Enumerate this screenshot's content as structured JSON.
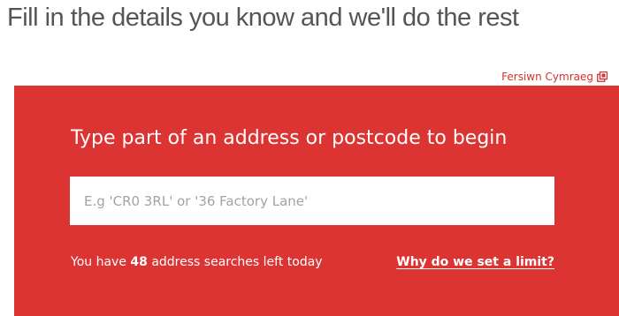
{
  "header": {
    "headline": "Fill in the details you know and we'll do the rest",
    "language_link": "Fersiwn Cymraeg",
    "language_icon": "external-link-icon"
  },
  "search_panel": {
    "prompt": "Type part of an address or postcode to begin",
    "search_placeholder": "E.g 'CR0 3RL' or '36 Factory Lane'",
    "search_value": "",
    "quota_prefix": "You have",
    "quota_count": "48",
    "quota_suffix": "address searches left today",
    "limit_link": "Why do we set a limit?"
  },
  "colors": {
    "accent": "#dc3333",
    "headline": "#555555",
    "placeholder": "#a3a3a3"
  }
}
